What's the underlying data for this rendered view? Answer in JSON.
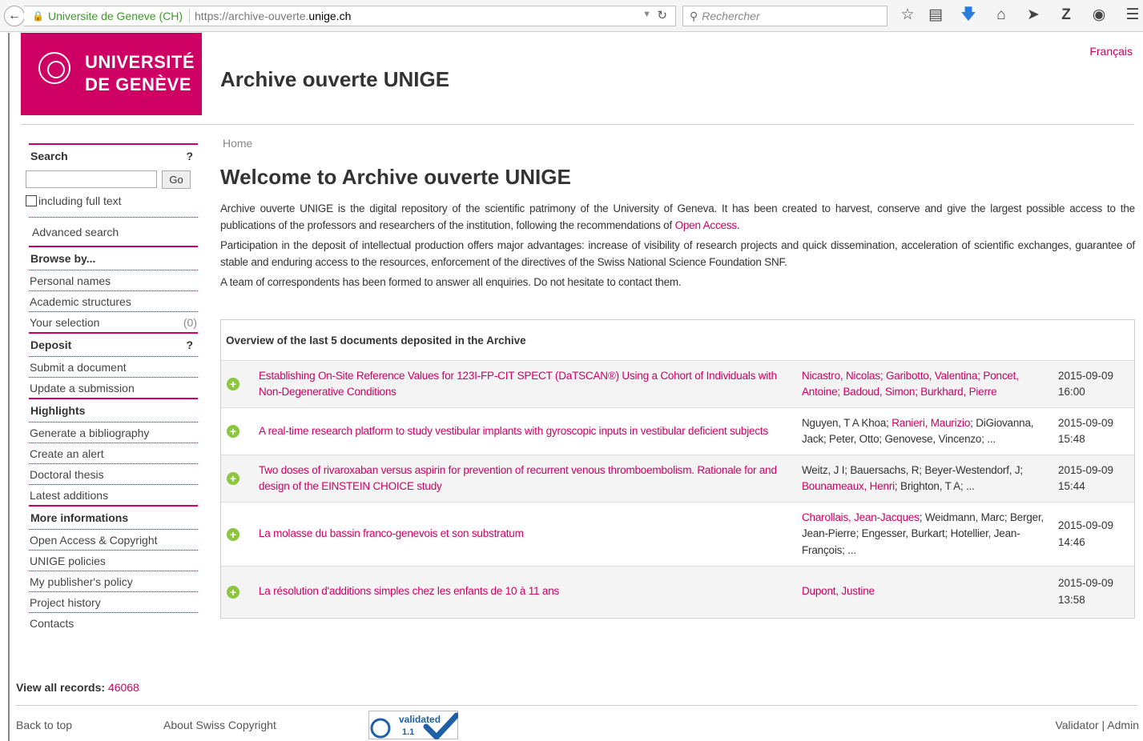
{
  "browser": {
    "site_identity": "Universite de Geneve (CH)",
    "url_prefix": "https://archive-ouverte.",
    "url_domain": "unige.ch",
    "search_placeholder": "Rechercher"
  },
  "header": {
    "logo_line1": "UNIVERSITÉ",
    "logo_line2": "DE GENÈVE",
    "site_title": "Archive ouverte UNIGE",
    "language_link": "Français"
  },
  "sidebar": {
    "search_title": "Search",
    "search_help": "?",
    "go_label": "Go",
    "fulltext_label": "including full text",
    "advanced_search": "Advanced search",
    "browse_title": "Browse by...",
    "browse_items": [
      "Personal names",
      "Academic structures"
    ],
    "your_selection": "Your selection",
    "selection_count": "(0)",
    "deposit_title": "Deposit",
    "deposit_help": "?",
    "deposit_items": [
      "Submit a document",
      "Update a submission"
    ],
    "highlights_title": "Highlights",
    "highlights_items": [
      "Generate a bibliography",
      "Create an alert",
      "Doctoral thesis",
      "Latest additions"
    ],
    "more_title": "More informations",
    "more_items": [
      "Open Access & Copyright",
      "UNIGE policies",
      "My publisher's policy",
      "Project history",
      "Contacts"
    ]
  },
  "main": {
    "breadcrumb": "Home",
    "welcome_title": "Welcome to Archive ouverte UNIGE",
    "intro_p1_text": "Archive ouverte UNIGE is the digital repository of the scientific patrimony of the University of Geneva. It has been created to harvest, conserve and give the largest possible access to the publications of the professors and researchers of the institution, following the recommendations of ",
    "intro_p1_link": "Open Access",
    "intro_p1_end": ".",
    "intro_p2": "Participation in the deposit of intellectual production offers major advantages: increase of visibility of research projects and quick dissemination, acceleration of scientific exchanges, guarantee of stable and enduring access to the resources, enforcement of the directives of the Swiss National Science Foundation SNF.",
    "intro_p3": "A team of correspondents has been formed to answer all enquiries. Do not hesitate to contact them.",
    "recent_title": "Overview of the last 5 documents deposited in the Archive",
    "documents": [
      {
        "title": "Establishing On-Site Reference Values for 123I-FP-CIT SPECT (DaTSCAN®) Using a Cohort of Individuals with Non-Degenerative Conditions",
        "authors_linked": "Nicastro, Nicolas; Garibotto, Valentina; Poncet, Antoine; Badoud, Simon; Burkhard, Pierre",
        "date": "2015-09-09",
        "time": "16:00"
      },
      {
        "title": "A real-time research platform to study vestibular implants with gyroscopic inputs in vestibular deficient subjects",
        "authors_a": "Nguyen, T A Khoa; ",
        "authors_b": "Ranieri, Maurizio",
        "authors_c": "; DiGiovanna, Jack; Peter, Otto; Genovese, Vincenzo; ...",
        "date": "2015-09-09",
        "time": "15:48"
      },
      {
        "title": "Two doses of rivaroxaban versus aspirin for prevention of recurrent venous thromboembolism. Rationale for and design of the EINSTEIN CHOICE study",
        "authors_a": "Weitz, J I; Bauersachs, R; Beyer-Westendorf, J; ",
        "authors_b": "Bounameaux, Henri",
        "authors_c": "; Brighton, T A; ...",
        "date": "2015-09-09",
        "time": "15:44"
      },
      {
        "title": "La molasse du bassin franco-genevois et son substratum",
        "authors_a": "",
        "authors_b": "Charollais, Jean-Jacques",
        "authors_c": "; Weidmann, Marc; Berger, Jean-Pierre; Engesser, Burkart; Hotellier, Jean-François; ...",
        "date": "2015-09-09",
        "time": "14:46"
      },
      {
        "title": "La résolution d'additions simples chez les enfants de 10 à 11 ans",
        "authors_linked": "Dupont, Justine",
        "date": "2015-09-09",
        "time": "13:58"
      }
    ]
  },
  "footer": {
    "view_all_label": "View all records:",
    "view_all_count": "46068",
    "back_to_top": "Back to top",
    "about_copyright": "About Swiss Copyright",
    "badge_text": "validated",
    "badge_version": "1.1",
    "validator": "Validator",
    "separator": "|",
    "admin": "Admin"
  },
  "colors": {
    "brand": "#cf0063",
    "plus": "#8cc63e",
    "badge": "#1f5fa8"
  }
}
